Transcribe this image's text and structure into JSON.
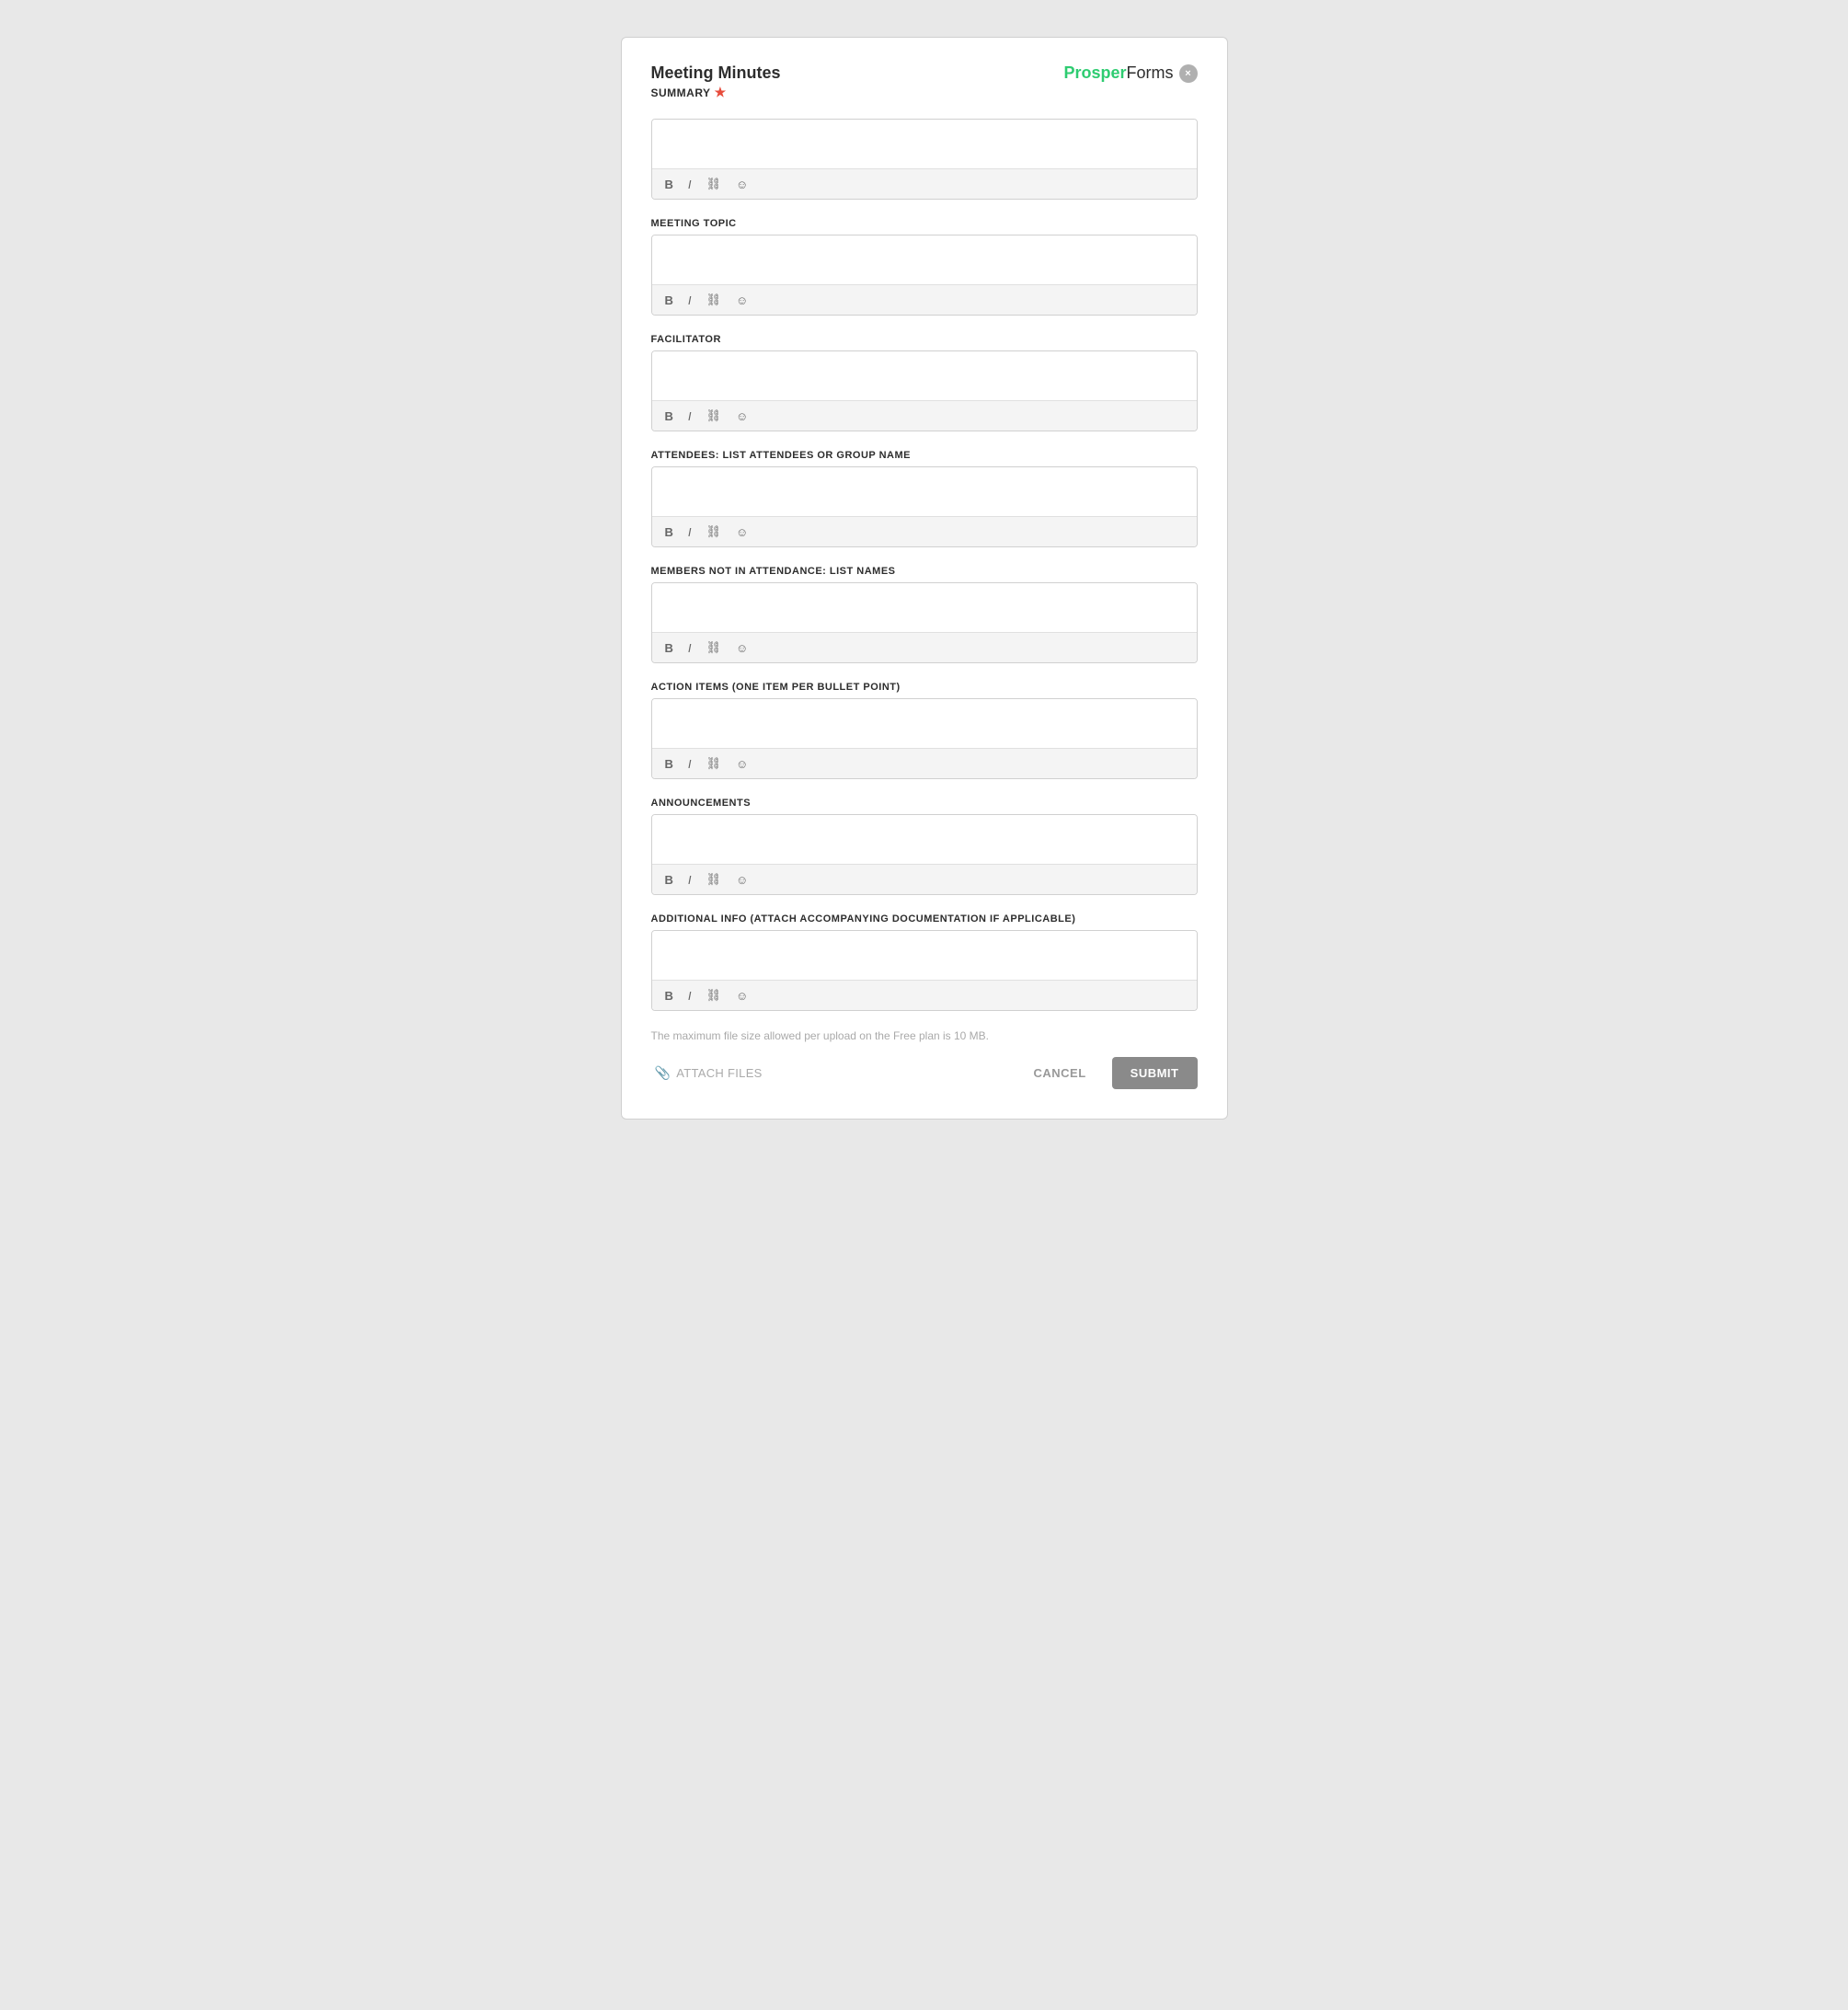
{
  "header": {
    "title": "Meeting Minutes",
    "subtitle": "SUMMARY",
    "required_indicator": "★",
    "logo_prosper": "Prosper",
    "logo_forms": "Forms",
    "close_label": "×"
  },
  "fields": [
    {
      "id": "summary",
      "label": "SUMMARY",
      "required": true,
      "toolbar": {
        "bold": "B",
        "italic": "I",
        "link": "⛓",
        "emoji": "☺"
      }
    },
    {
      "id": "meeting_topic",
      "label": "MEETING TOPIC",
      "required": false,
      "toolbar": {
        "bold": "B",
        "italic": "I",
        "link": "⛓",
        "emoji": "☺"
      }
    },
    {
      "id": "facilitator",
      "label": "FACILITATOR",
      "required": false,
      "toolbar": {
        "bold": "B",
        "italic": "I",
        "link": "⛓",
        "emoji": "☺"
      }
    },
    {
      "id": "attendees",
      "label": "ATTENDEES: LIST ATTENDEES OR GROUP NAME",
      "required": false,
      "toolbar": {
        "bold": "B",
        "italic": "I",
        "link": "⛓",
        "emoji": "☺"
      }
    },
    {
      "id": "members_not_in_attendance",
      "label": "MEMBERS NOT IN ATTENDANCE: LIST NAMES",
      "required": false,
      "toolbar": {
        "bold": "B",
        "italic": "I",
        "link": "⛓",
        "emoji": "☺"
      }
    },
    {
      "id": "action_items",
      "label": "ACTION ITEMS (ONE ITEM PER BULLET POINT)",
      "required": false,
      "toolbar": {
        "bold": "B",
        "italic": "I",
        "link": "⛓",
        "emoji": "☺"
      }
    },
    {
      "id": "announcements",
      "label": "ANNOUNCEMENTS",
      "required": false,
      "toolbar": {
        "bold": "B",
        "italic": "I",
        "link": "⛓",
        "emoji": "☺"
      }
    },
    {
      "id": "additional_info",
      "label": "ADDITIONAL INFO (ATTACH ACCOMPANYING DOCUMENTATION IF APPLICABLE)",
      "required": false,
      "toolbar": {
        "bold": "B",
        "italic": "I",
        "link": "⛓",
        "emoji": "☺"
      }
    }
  ],
  "footer": {
    "file_size_note": "The maximum file size allowed per upload on the Free plan is 10 MB.",
    "attach_files_label": "ATTACH FILES",
    "cancel_label": "CANCEL",
    "submit_label": "SUBMIT"
  }
}
